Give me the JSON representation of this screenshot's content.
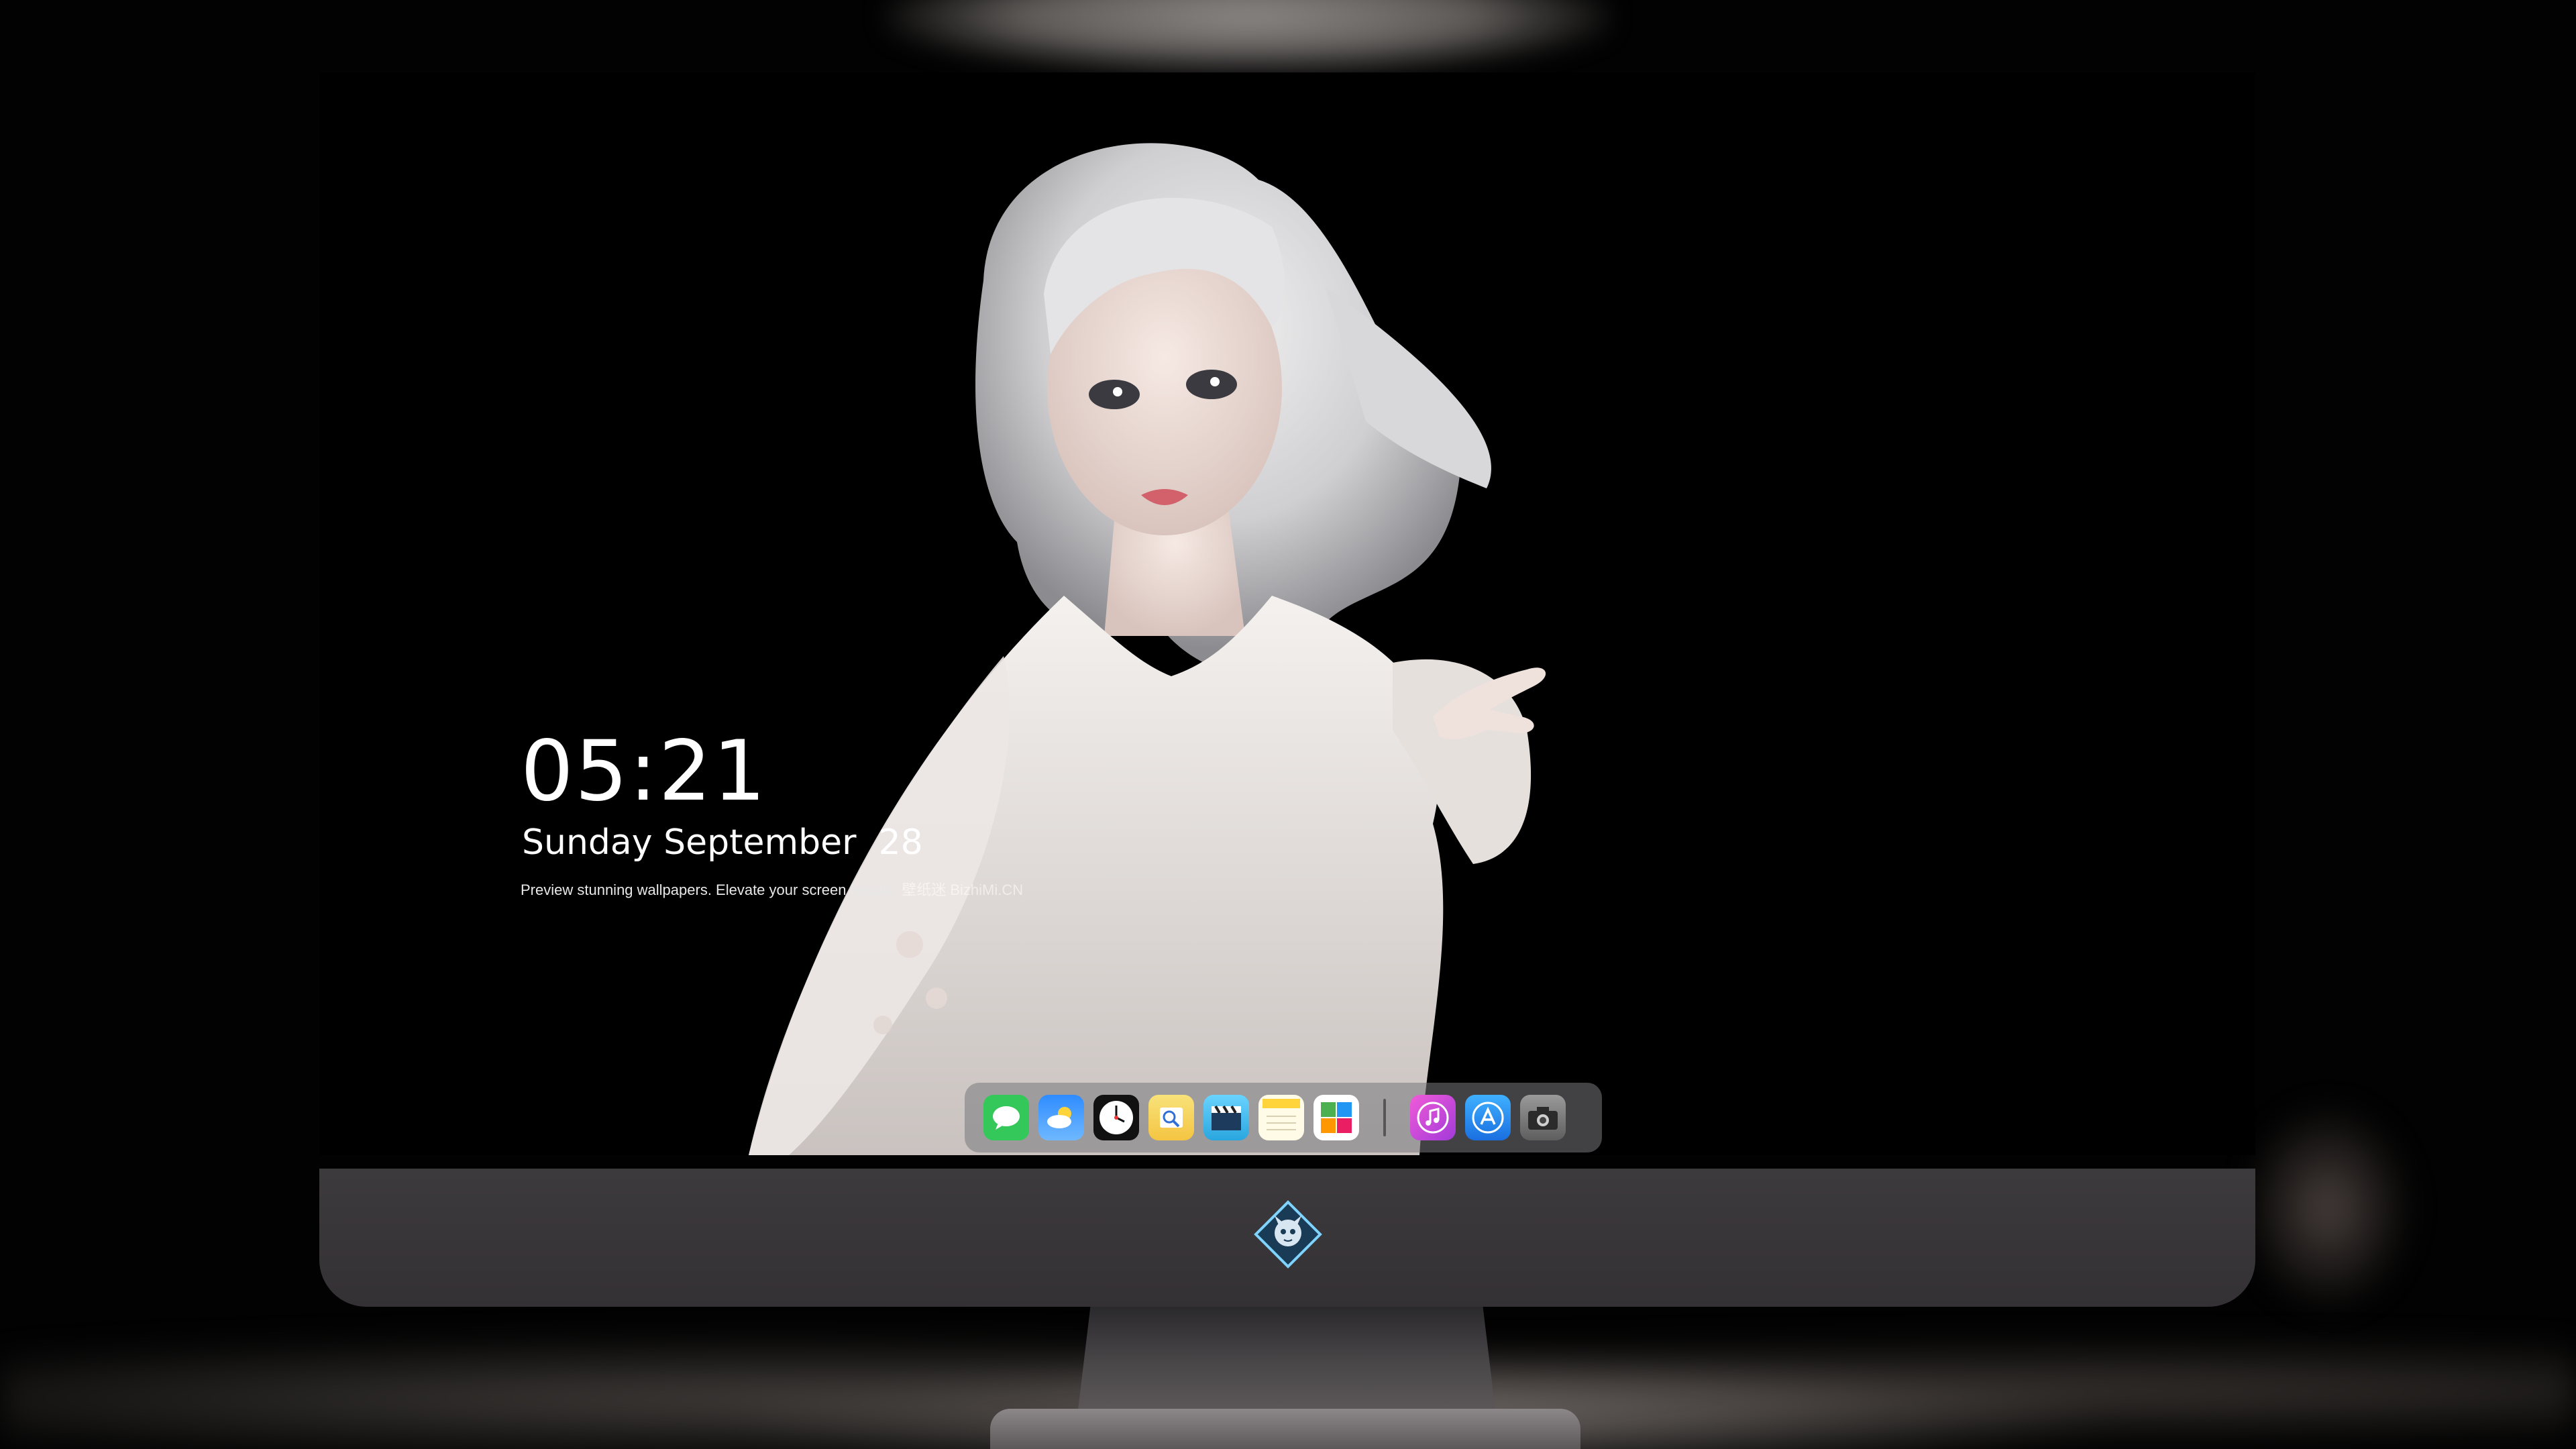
{
  "lock_screen": {
    "time": "05:21",
    "date": "Sunday September  28",
    "tagline": "Preview stunning wallpapers. Elevate your screen beauty.",
    "brand": "壁纸迷  BizhiMi.CN"
  },
  "dock": {
    "apps_left": [
      {
        "name": "messages-icon",
        "color": "#34c759"
      },
      {
        "name": "weather-icon",
        "color": "#2f8cff"
      },
      {
        "name": "clock-icon",
        "color": "#111111"
      },
      {
        "name": "preview-icon",
        "color": "#f4c542"
      },
      {
        "name": "video-icon",
        "color": "#39b6e8"
      },
      {
        "name": "notes-icon",
        "color": "#ffd43b"
      },
      {
        "name": "photos-icon",
        "color": "#ffffff"
      }
    ],
    "apps_right": [
      {
        "name": "music-icon",
        "color": "#d83bd2"
      },
      {
        "name": "app-store-icon",
        "color": "#1f8bff"
      },
      {
        "name": "camera-icon",
        "color": "#7a7a7a"
      }
    ]
  },
  "monitor": {
    "logo": "dragon-logo-icon"
  }
}
